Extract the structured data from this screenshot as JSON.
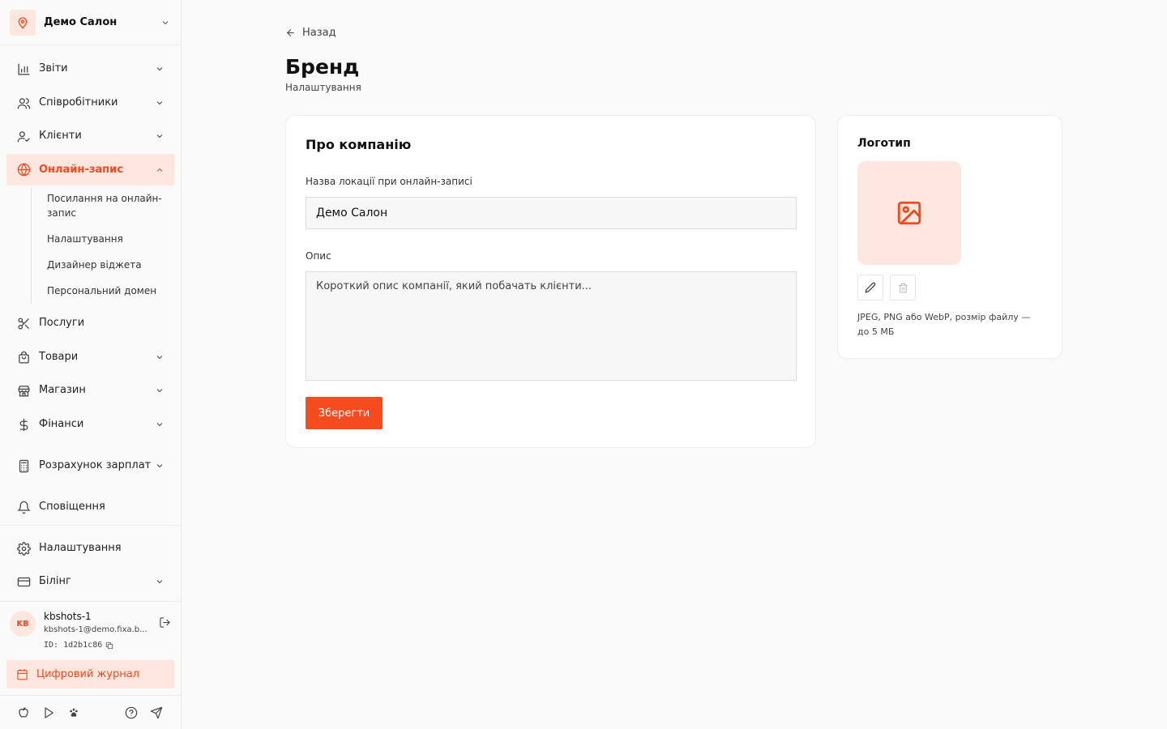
{
  "sidebar": {
    "location": {
      "name": "Демо Салон",
      "icon": "map-pin-icon"
    },
    "items": [
      {
        "label": "Звіти",
        "icon": "bar-chart-icon",
        "has_chevron": true
      },
      {
        "label": "Співробітники",
        "icon": "users-icon",
        "has_chevron": true
      },
      {
        "label": "Клієнти",
        "icon": "user-check-icon",
        "has_chevron": true
      },
      {
        "label": "Онлайн-запис",
        "icon": "globe-icon",
        "has_chevron": true,
        "active": true
      },
      {
        "label": "Послуги",
        "icon": "scissors-icon",
        "has_chevron": false
      },
      {
        "label": "Товари",
        "icon": "shopping-bag-icon",
        "has_chevron": true
      },
      {
        "label": "Магазин",
        "icon": "store-icon",
        "has_chevron": true
      },
      {
        "label": "Фінанси",
        "icon": "dollar-icon",
        "has_chevron": true
      },
      {
        "label": "Розрахунок зарплат",
        "icon": "calculator-icon",
        "has_chevron": true
      },
      {
        "label": "Сповіщення",
        "icon": "bell-icon",
        "has_chevron": false
      },
      {
        "label": "Налаштування",
        "icon": "gear-icon",
        "has_chevron": false
      },
      {
        "label": "Білінг",
        "icon": "credit-card-icon",
        "has_chevron": true
      }
    ],
    "sub_items": [
      {
        "label": "Посилання на онлайн-запис"
      },
      {
        "label": "Налаштування"
      },
      {
        "label": "Дизайнер віджета"
      },
      {
        "label": "Персональний домен"
      }
    ],
    "user": {
      "initials": "KB",
      "name": "kbshots-1",
      "email": "kbshots-1@demo.fixa.b...",
      "id": "ID: 1d2b1c86"
    },
    "journal": {
      "label": "Цифровий журнал",
      "icon": "calendar-icon"
    },
    "bottom_icons": [
      "apple-icon",
      "play-store-icon",
      "paw-icon",
      "help-icon",
      "telegram-icon"
    ]
  },
  "main": {
    "back_label": "Назад",
    "title": "Бренд",
    "subtitle": "Налаштування",
    "about": {
      "title": "Про компанію",
      "name_label": "Назва локації при онлайн-записі",
      "name_value": "Демо Салон",
      "description_label": "Опис",
      "description_placeholder": "Короткий опис компанії, який побачать клієнти...",
      "save_label": "Зберегти"
    },
    "logo": {
      "title": "Логотип",
      "hint": "JPEG, PNG або WebP, розмір файлу — до 5 МБ"
    }
  },
  "colors": {
    "accent": "#f54b1f",
    "accent_light": "#fde7df",
    "background": "#f9f9f9"
  }
}
